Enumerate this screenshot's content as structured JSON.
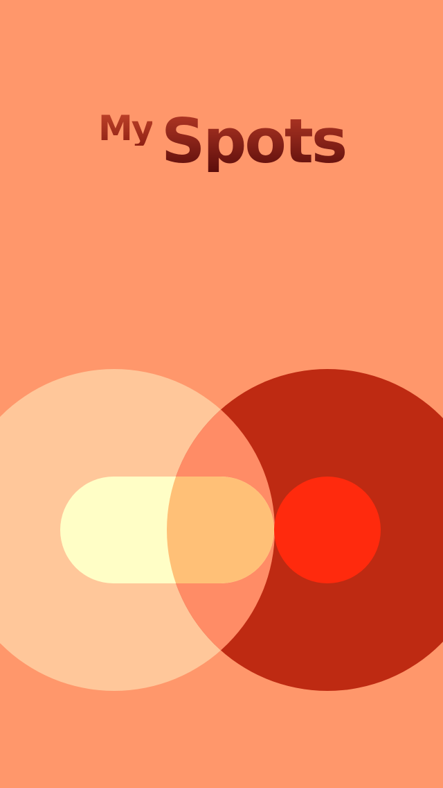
{
  "app": {
    "logo_prefix": "My",
    "logo_main": "Spots"
  },
  "colors": {
    "background": "#FF976B",
    "logo_prefix": "#A8301C",
    "logo_main": "#7A1712",
    "left_circle": "#FFC79A",
    "right_circle": "#BE2A12",
    "overlap": "#FF8C66",
    "pill": "#FFFEC6",
    "pill_overlap": "#FFC077",
    "dot": "#FF2A0D"
  },
  "graphic": {
    "shapes": [
      "left-circle",
      "right-circle",
      "overlap-lens",
      "pill",
      "red-dot"
    ]
  }
}
